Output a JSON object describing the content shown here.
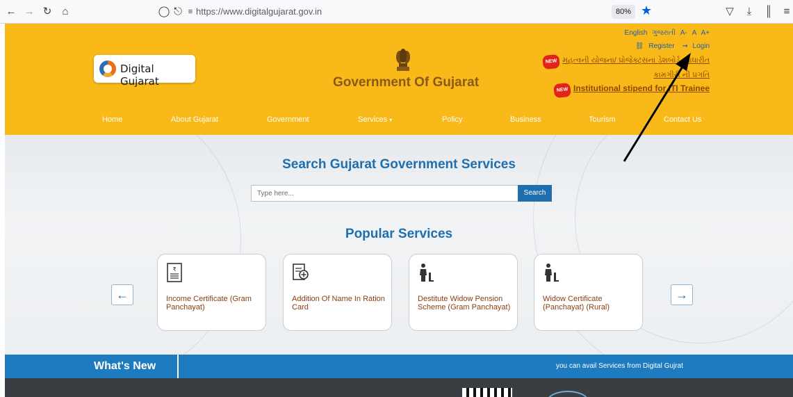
{
  "browser": {
    "url": "https://www.digitalgujarat.gov.in",
    "zoom": "80%",
    "icons": [
      "back-arrow-icon",
      "forward-arrow-icon",
      "reload-icon",
      "home-icon",
      "shield-icon",
      "lock-icon",
      "permissions-icon",
      "bookmark-star-icon",
      "pocket-icon",
      "download-icon",
      "library-icon",
      "menu-icon"
    ]
  },
  "header": {
    "logo_text": "Digital Gujarat",
    "gov_title": "Government Of Gujarat",
    "lang_links": [
      "English",
      "ગુજરાતી",
      "A-",
      "A",
      "A+"
    ],
    "register_label": "Register",
    "login_label": "Login",
    "new_badge": "NEW",
    "news_1": "મહત્વની યોજના/ પ્રોજેક્ટ્સના ડેશબોર્ડ આધારીત કામગીરી ની પ્રગતિ",
    "news_2": "Institutional stipend for ITI Trainee"
  },
  "nav": {
    "items": [
      "Home",
      "About Gujarat",
      "Government",
      "Services",
      "Policy",
      "Business",
      "Tourism",
      "Contact Us"
    ]
  },
  "search": {
    "title": "Search Gujarat Government Services",
    "placeholder": "Type here...",
    "button": "Search"
  },
  "popular": {
    "title": "Popular Services",
    "cards": [
      {
        "label": "Income Certificate (Gram Panchayat)",
        "icon": "certificate-icon"
      },
      {
        "label": "Addition Of Name In Ration Card",
        "icon": "add-document-icon"
      },
      {
        "label": "Destitute Widow Pension Scheme (Gram Panchayat)",
        "icon": "widow-icon"
      },
      {
        "label": "Widow Certificate (Panchayat) (Rural)",
        "icon": "widow-icon"
      }
    ]
  },
  "whats_new": {
    "title": "What's New",
    "ticker": "you can avail Services from Digital Gujrat"
  },
  "colors": {
    "header_bg": "#f9b918",
    "primary_blue": "#1f6fae",
    "whats_new_bg": "#1f7bc0",
    "link_blue": "#1f5fa8"
  }
}
